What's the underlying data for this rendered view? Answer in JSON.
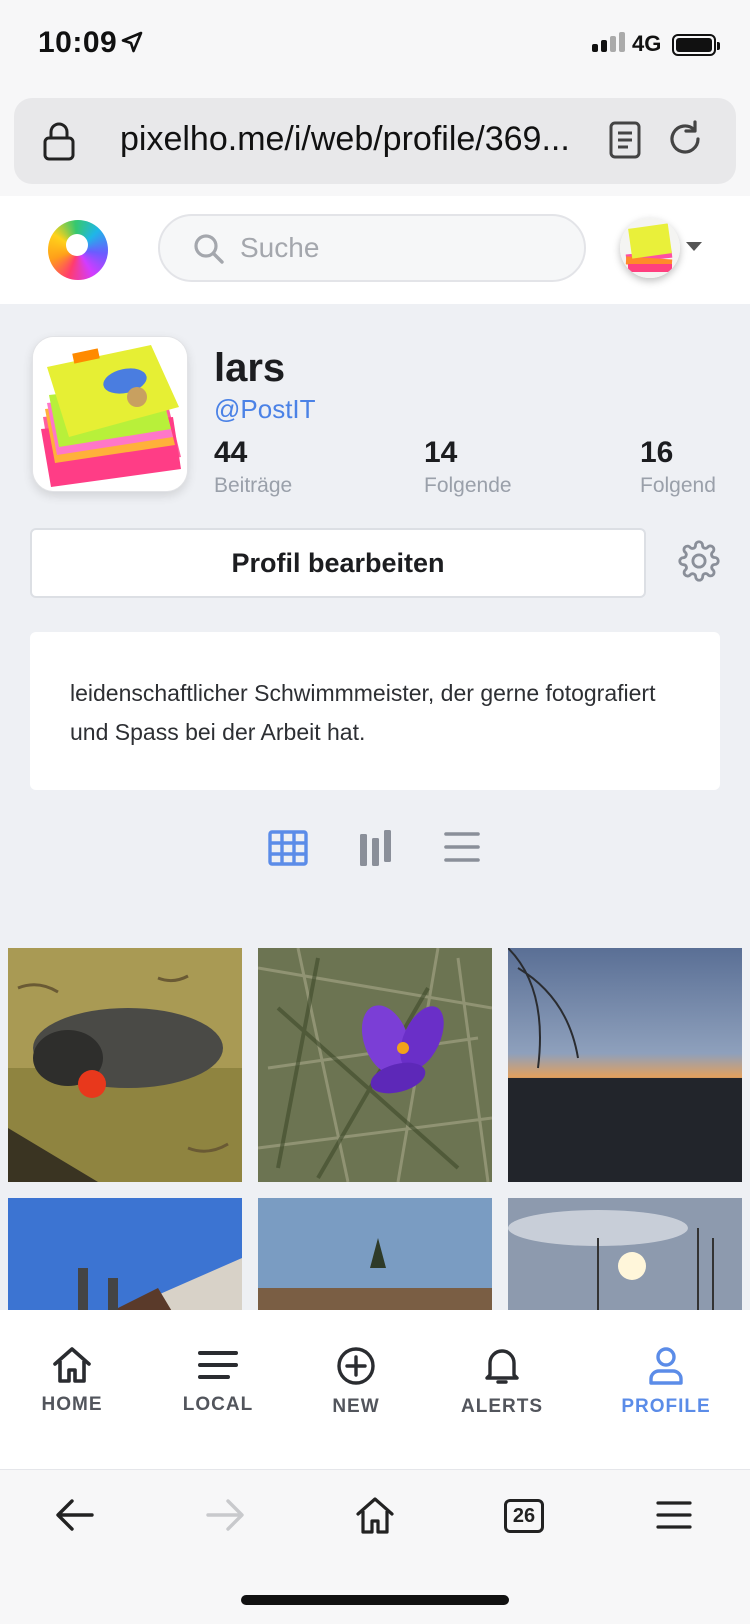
{
  "status_bar": {
    "time": "10:09",
    "network": "4G"
  },
  "browser": {
    "url": "pixelho.me/i/web/profile/369...",
    "tab_count": "26"
  },
  "header": {
    "search_placeholder": "Suche"
  },
  "profile": {
    "name": "lars",
    "handle": "@PostIT",
    "stats": [
      {
        "value": "44",
        "label": "Beiträge"
      },
      {
        "value": "14",
        "label": "Folgende"
      },
      {
        "value": "16",
        "label": "Folgend"
      }
    ],
    "edit_label": "Profil bearbeiten",
    "bio": "leidenschaftlicher Schwimmmeister, der gerne fotografiert und Spass bei der Arbeit hat."
  },
  "nav": {
    "items": [
      {
        "label": "HOME",
        "icon": "home-icon"
      },
      {
        "label": "LOCAL",
        "icon": "local-feed-icon"
      },
      {
        "label": "NEW",
        "icon": "plus-circle-icon"
      },
      {
        "label": "ALERTS",
        "icon": "bell-icon"
      },
      {
        "label": "PROFILE",
        "icon": "user-icon"
      }
    ],
    "active": "PROFILE"
  },
  "colors": {
    "accent": "#5b8ce8",
    "handle": "#4b82e6",
    "page_bg": "#eef0f4"
  }
}
